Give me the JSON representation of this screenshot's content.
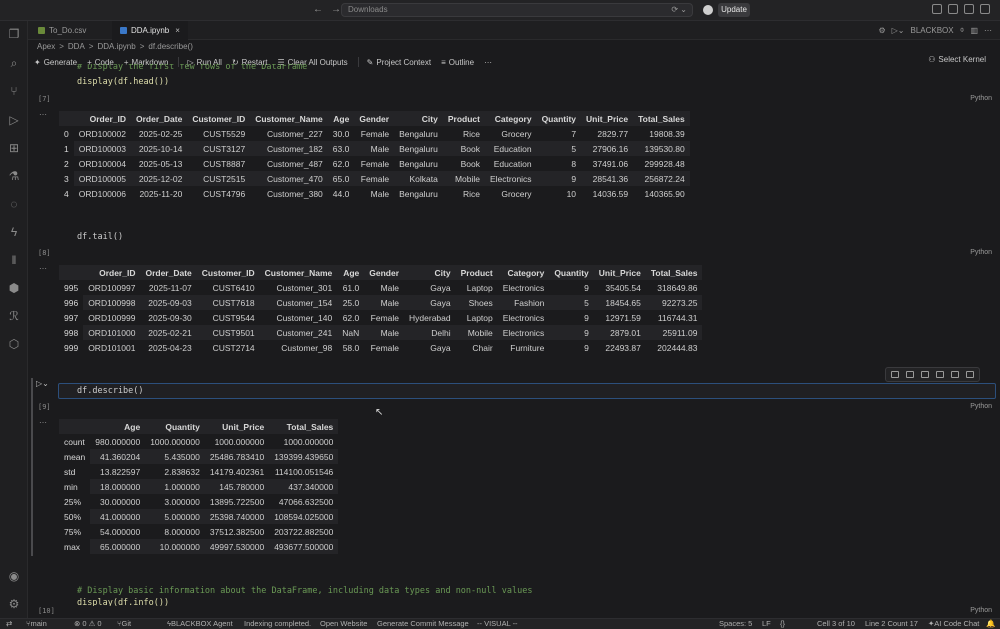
{
  "titlebar": {
    "search_placeholder": "Downloads",
    "update_label": "Update"
  },
  "tabs": [
    {
      "label": "To_Do.csv",
      "active": false
    },
    {
      "label": "DDA.ipynb",
      "active": true,
      "close": "×"
    }
  ],
  "tabbar_right": {
    "agent_label": "BLACKBOX"
  },
  "breadcrumb": [
    "Apex",
    ">",
    "DDA",
    ">",
    "DDA.ipynb",
    ">",
    "df.describe()"
  ],
  "toolbar": {
    "generate": "Generate",
    "code": "Code",
    "markdown": "Markdown",
    "run_all": "Run All",
    "restart": "Restart",
    "clear_outputs": "Clear All Outputs",
    "project_context": "Project Context",
    "outline": "Outline",
    "more": "···",
    "select_kernel": "Select Kernel"
  },
  "cells": [
    {
      "partial_code": "# Display the first few rows of the DataFrame",
      "code": "display(df.head())",
      "number": "[7]",
      "lang": "Python",
      "output": {
        "columns": [
          "",
          "Order_ID",
          "Order_Date",
          "Customer_ID",
          "Customer_Name",
          "Age",
          "Gender",
          "City",
          "Product",
          "Category",
          "Quantity",
          "Unit_Price",
          "Total_Sales"
        ],
        "rows": [
          [
            "0",
            "ORD100002",
            "2025-02-25",
            "CUST5529",
            "Customer_227",
            "30.0",
            "Female",
            "Bengaluru",
            "Rice",
            "Grocery",
            "7",
            "2829.77",
            "19808.39"
          ],
          [
            "1",
            "ORD100003",
            "2025-10-14",
            "CUST3127",
            "Customer_182",
            "63.0",
            "Male",
            "Bengaluru",
            "Book",
            "Education",
            "5",
            "27906.16",
            "139530.80"
          ],
          [
            "2",
            "ORD100004",
            "2025-05-13",
            "CUST8887",
            "Customer_487",
            "62.0",
            "Female",
            "Bengaluru",
            "Book",
            "Education",
            "8",
            "37491.06",
            "299928.48"
          ],
          [
            "3",
            "ORD100005",
            "2025-12-02",
            "CUST2515",
            "Customer_470",
            "65.0",
            "Female",
            "Kolkata",
            "Mobile",
            "Electronics",
            "9",
            "28541.36",
            "256872.24"
          ],
          [
            "4",
            "ORD100006",
            "2025-11-20",
            "CUST4796",
            "Customer_380",
            "44.0",
            "Male",
            "Bengaluru",
            "Rice",
            "Grocery",
            "10",
            "14036.59",
            "140365.90"
          ]
        ]
      }
    },
    {
      "code": "df.tail()",
      "number": "[8]",
      "lang": "Python",
      "output": {
        "columns": [
          "",
          "Order_ID",
          "Order_Date",
          "Customer_ID",
          "Customer_Name",
          "Age",
          "Gender",
          "City",
          "Product",
          "Category",
          "Quantity",
          "Unit_Price",
          "Total_Sales"
        ],
        "rows": [
          [
            "995",
            "ORD100997",
            "2025-11-07",
            "CUST6410",
            "Customer_301",
            "61.0",
            "Male",
            "Gaya",
            "Laptop",
            "Electronics",
            "9",
            "35405.54",
            "318649.86"
          ],
          [
            "996",
            "ORD100998",
            "2025-09-03",
            "CUST7618",
            "Customer_154",
            "25.0",
            "Male",
            "Gaya",
            "Shoes",
            "Fashion",
            "5",
            "18454.65",
            "92273.25"
          ],
          [
            "997",
            "ORD100999",
            "2025-09-30",
            "CUST9544",
            "Customer_140",
            "62.0",
            "Female",
            "Hyderabad",
            "Laptop",
            "Electronics",
            "9",
            "12971.59",
            "116744.31"
          ],
          [
            "998",
            "ORD101000",
            "2025-02-21",
            "CUST9501",
            "Customer_241",
            "NaN",
            "Male",
            "Delhi",
            "Mobile",
            "Electronics",
            "9",
            "2879.01",
            "25911.09"
          ],
          [
            "999",
            "ORD101001",
            "2025-04-23",
            "CUST2714",
            "Customer_98",
            "58.0",
            "Female",
            "Gaya",
            "Chair",
            "Furniture",
            "9",
            "22493.87",
            "202444.83"
          ]
        ]
      }
    },
    {
      "code": "df.describe()",
      "number": "[9]",
      "lang": "Python",
      "output": {
        "columns": [
          "",
          "Age",
          "Quantity",
          "Unit_Price",
          "Total_Sales"
        ],
        "rows": [
          [
            "count",
            "980.000000",
            "1000.000000",
            "1000.000000",
            "1000.000000"
          ],
          [
            "mean",
            "41.360204",
            "5.435000",
            "25486.783410",
            "139399.439650"
          ],
          [
            "std",
            "13.822597",
            "2.838632",
            "14179.402361",
            "114100.051546"
          ],
          [
            "min",
            "18.000000",
            "1.000000",
            "145.780000",
            "437.340000"
          ],
          [
            "25%",
            "30.000000",
            "3.000000",
            "13895.722500",
            "47066.632500"
          ],
          [
            "50%",
            "41.000000",
            "5.000000",
            "25398.740000",
            "108594.025000"
          ],
          [
            "75%",
            "54.000000",
            "8.000000",
            "37512.382500",
            "203722.882500"
          ],
          [
            "max",
            "65.000000",
            "10.000000",
            "49997.530000",
            "493677.500000"
          ]
        ]
      }
    },
    {
      "code_comment": "# Display basic information about the DataFrame, including data types and non-null values",
      "code": "display(df.info())",
      "number": "[10]",
      "lang": "Python"
    }
  ],
  "statusbar": {
    "branch": "main",
    "problems": "⊗ 0 ⚠ 0",
    "git": "Git",
    "agent": "BLACKBOX Agent",
    "indexing": "Indexing completed.",
    "website": "Open Website",
    "commit": "Generate Commit Message",
    "mode": "-- VISUAL --",
    "spaces": "Spaces: 5",
    "eol": "LF",
    "braces": "{}",
    "cell": "Cell 3 of 10",
    "line": "Line 2 Count 17",
    "chat": "AI Code Chat"
  }
}
